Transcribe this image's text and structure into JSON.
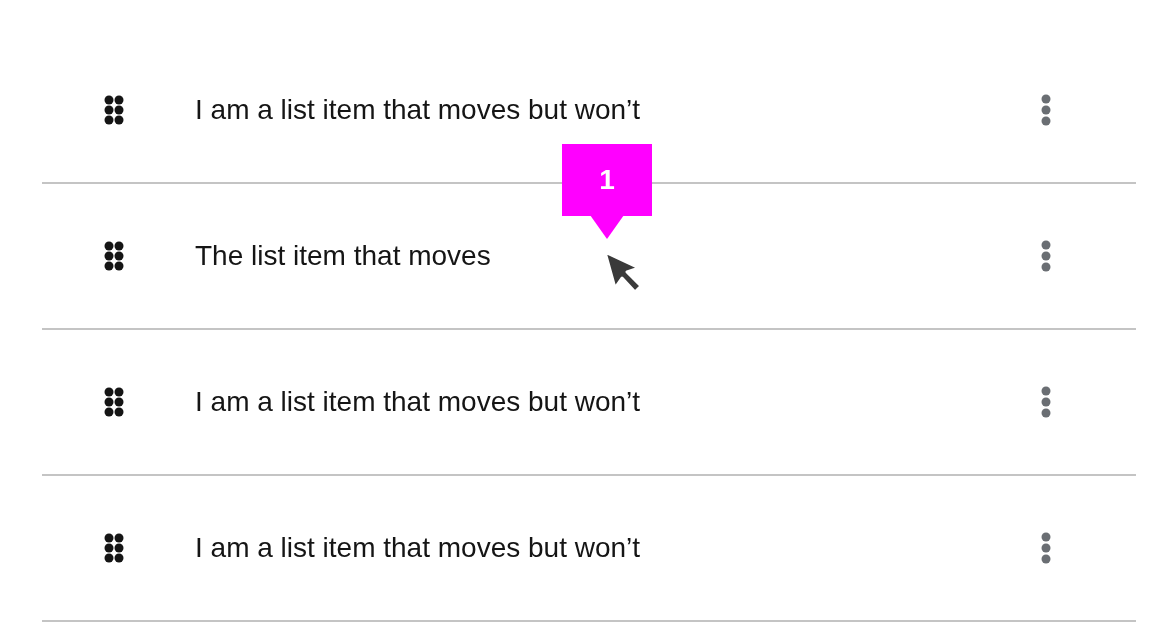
{
  "list_items": [
    {
      "label": "I am a list item that moves but won’t"
    },
    {
      "label": "The list item that moves"
    },
    {
      "label": "I am a list item that moves but won’t"
    },
    {
      "label": "I am a list item that moves but won’t"
    }
  ],
  "callout": {
    "label": "1"
  }
}
